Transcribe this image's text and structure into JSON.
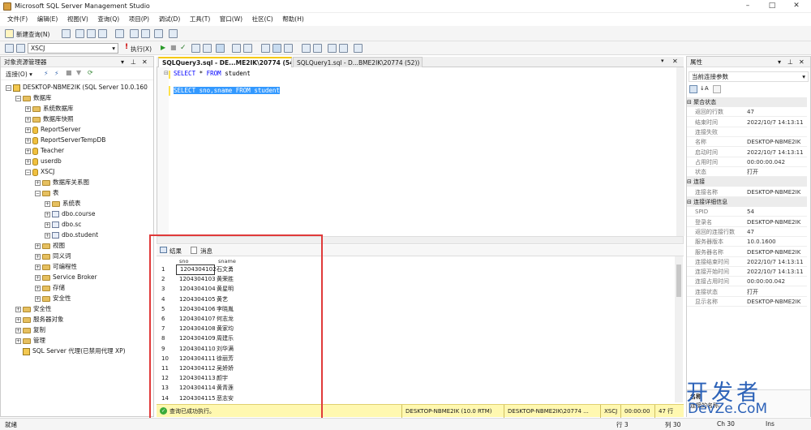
{
  "window": {
    "title": "Microsoft SQL Server Management Studio",
    "minimize": "–",
    "maximize": "□",
    "close": "✕"
  },
  "menu": [
    "文件(F)",
    "编辑(E)",
    "视图(V)",
    "查询(Q)",
    "项目(P)",
    "调试(D)",
    "工具(T)",
    "窗口(W)",
    "社区(C)",
    "帮助(H)"
  ],
  "toolbar": {
    "new_query": "新建查询(N)",
    "database": "XSCJ",
    "execute": "执行(X)"
  },
  "object_explorer": {
    "title": "对象资源管理器",
    "connect": "连接(O) ▾",
    "items": [
      {
        "label": "DESKTOP-NBME2IK (SQL Server 10.0.160",
        "depth": 0,
        "exp": "⊟",
        "icon": "srv"
      },
      {
        "label": "数据库",
        "depth": 1,
        "exp": "⊟",
        "icon": "fold"
      },
      {
        "label": "系统数据库",
        "depth": 2,
        "exp": "⊞",
        "icon": "fold"
      },
      {
        "label": "数据库快照",
        "depth": 2,
        "exp": "⊞",
        "icon": "fold"
      },
      {
        "label": "ReportServer",
        "depth": 2,
        "exp": "⊞",
        "icon": "db"
      },
      {
        "label": "ReportServerTempDB",
        "depth": 2,
        "exp": "⊞",
        "icon": "db"
      },
      {
        "label": "Teacher",
        "depth": 2,
        "exp": "⊞",
        "icon": "db"
      },
      {
        "label": "userdb",
        "depth": 2,
        "exp": "⊞",
        "icon": "db"
      },
      {
        "label": "XSCJ",
        "depth": 2,
        "exp": "⊟",
        "icon": "db"
      },
      {
        "label": "数据库关系图",
        "depth": 3,
        "exp": "⊞",
        "icon": "fold"
      },
      {
        "label": "表",
        "depth": 3,
        "exp": "⊟",
        "icon": "fold"
      },
      {
        "label": "系统表",
        "depth": 4,
        "exp": "⊞",
        "icon": "fold"
      },
      {
        "label": "dbo.course",
        "depth": 4,
        "exp": "⊞",
        "icon": "tbl"
      },
      {
        "label": "dbo.sc",
        "depth": 4,
        "exp": "⊞",
        "icon": "tbl"
      },
      {
        "label": "dbo.student",
        "depth": 4,
        "exp": "⊞",
        "icon": "tbl"
      },
      {
        "label": "视图",
        "depth": 3,
        "exp": "⊞",
        "icon": "fold"
      },
      {
        "label": "同义词",
        "depth": 3,
        "exp": "⊞",
        "icon": "fold"
      },
      {
        "label": "可编程性",
        "depth": 3,
        "exp": "⊞",
        "icon": "fold"
      },
      {
        "label": "Service Broker",
        "depth": 3,
        "exp": "⊞",
        "icon": "fold"
      },
      {
        "label": "存储",
        "depth": 3,
        "exp": "⊞",
        "icon": "fold"
      },
      {
        "label": "安全性",
        "depth": 3,
        "exp": "⊞",
        "icon": "fold"
      },
      {
        "label": "安全性",
        "depth": 1,
        "exp": "⊞",
        "icon": "fold"
      },
      {
        "label": "服务器对象",
        "depth": 1,
        "exp": "⊞",
        "icon": "fold"
      },
      {
        "label": "复制",
        "depth": 1,
        "exp": "⊞",
        "icon": "fold"
      },
      {
        "label": "管理",
        "depth": 1,
        "exp": "⊞",
        "icon": "fold"
      },
      {
        "label": "SQL Server 代理(已禁用代理 XP)",
        "depth": 1,
        "exp": "",
        "icon": "srv"
      }
    ]
  },
  "tabs": [
    {
      "label": "SQLQuery3.sql - DE...ME2IK\\20774 (54))*",
      "active": true
    },
    {
      "label": "SQLQuery1.sql - D...BME2IK\\20774 (52))",
      "active": false
    }
  ],
  "editor": {
    "line1_kw1": "SELECT",
    "line1_rest1": " * ",
    "line1_kw2": "FROM",
    "line1_rest2": " student",
    "line2": "SELECT sno,sname FROM student"
  },
  "results": {
    "tab_results": "结果",
    "tab_messages": "消息",
    "columns": [
      "sno",
      "sname"
    ],
    "rows": [
      [
        "1",
        "1204304102",
        "石文勇"
      ],
      [
        "2",
        "1204304103",
        "黄荣胜"
      ],
      [
        "3",
        "1204304104",
        "黄星明"
      ],
      [
        "4",
        "1204304105",
        "黄艺"
      ],
      [
        "5",
        "1204304106",
        "李晓胤"
      ],
      [
        "6",
        "1204304107",
        "何志龙"
      ],
      [
        "7",
        "1204304108",
        "黄家均"
      ],
      [
        "8",
        "1204304109",
        "周建乐"
      ],
      [
        "9",
        "1204304110",
        "刘华满"
      ],
      [
        "10",
        "1204304111",
        "徐丽芳"
      ],
      [
        "11",
        "1204304112",
        "吴娇娇"
      ],
      [
        "12",
        "1204304113",
        "颜宇"
      ],
      [
        "13",
        "1204304114",
        "黄青莲"
      ],
      [
        "14",
        "1204304115",
        "恶志安"
      ]
    ]
  },
  "query_status": {
    "message": "查询已成功执行。",
    "server": "DESKTOP-NBME2IK (10.0 RTM)",
    "user": "DESKTOP-NBME2IK\\20774 ...",
    "db": "XSCJ",
    "time": "00:00:00",
    "rows": "47 行"
  },
  "properties": {
    "title": "属性",
    "selector": "当前连接参数",
    "groups": [
      {
        "name": "聚合状态",
        "rows": [
          [
            "返回的行数",
            "47"
          ],
          [
            "结束时间",
            "2022/10/7 14:13:11"
          ],
          [
            "连接失败",
            ""
          ],
          [
            "名称",
            "DESKTOP-NBME2IK"
          ],
          [
            "启动时间",
            "2022/10/7 14:13:11"
          ],
          [
            "占用时间",
            "00:00:00.042"
          ],
          [
            "状态",
            "打开"
          ]
        ]
      },
      {
        "name": "连接",
        "rows": [
          [
            "连接名称",
            "DESKTOP-NBME2IK"
          ]
        ]
      },
      {
        "name": "连接详细信息",
        "rows": [
          [
            "SPID",
            "54"
          ],
          [
            "登录名",
            "DESKTOP-NBME2IK"
          ],
          [
            "返回的连接行数",
            "47"
          ],
          [
            "服务器版本",
            "10.0.1600"
          ],
          [
            "服务器名称",
            "DESKTOP-NBME2IK"
          ],
          [
            "连接结束时间",
            "2022/10/7 14:13:11"
          ],
          [
            "连接开始时间",
            "2022/10/7 14:13:11"
          ],
          [
            "连接占用时间",
            "00:00:00.042"
          ],
          [
            "连接状态",
            "打开"
          ],
          [
            "显示名称",
            "DESKTOP-NBME2IK"
          ]
        ]
      }
    ],
    "bottom_label": "名称",
    "bottom_hint": "连接的名称。"
  },
  "statusbar": {
    "ready": "就绪",
    "line": "行 3",
    "col": "列 30",
    "ch": "Ch 30",
    "ins": "Ins"
  },
  "watermark": {
    "line1": "开发者",
    "line2": "DevZe.CoM"
  }
}
